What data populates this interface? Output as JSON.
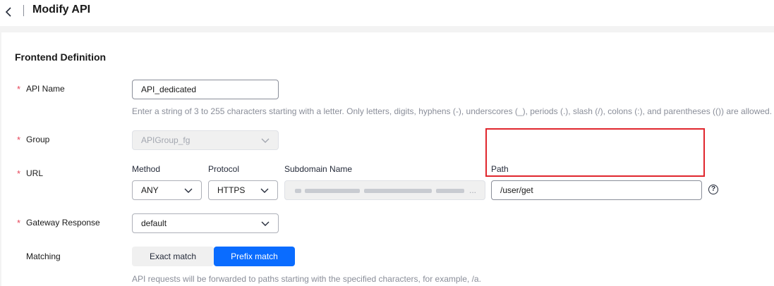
{
  "header": {
    "title": "Modify API"
  },
  "section": {
    "title": "Frontend Definition"
  },
  "api_name": {
    "label": "API Name",
    "value": "API_dedicated",
    "hint": "Enter a string of 3 to 255 characters starting with a letter. Only letters, digits, hyphens (-), underscores (_), periods (.), slash (/), colons (:), and parentheses (()) are allowed."
  },
  "group": {
    "label": "Group",
    "value": "APIGroup_fg"
  },
  "url": {
    "label": "URL",
    "method_label": "Method",
    "method_value": "ANY",
    "protocol_label": "Protocol",
    "protocol_value": "HTTPS",
    "subdomain_label": "Subdomain Name",
    "subdomain_ellipsis": "...",
    "path_label": "Path",
    "path_value": "/user/get",
    "help": "?"
  },
  "gateway_response": {
    "label": "Gateway Response",
    "value": "default"
  },
  "matching": {
    "label": "Matching",
    "options": [
      "Exact match",
      "Prefix match"
    ],
    "selected": "Prefix match",
    "hint": "API requests will be forwarded to paths starting with the specified characters, for example, /a."
  },
  "required_mark": "*",
  "colors": {
    "primary": "#0a6cff",
    "required": "#e6465a",
    "highlight": "#e0262d"
  }
}
